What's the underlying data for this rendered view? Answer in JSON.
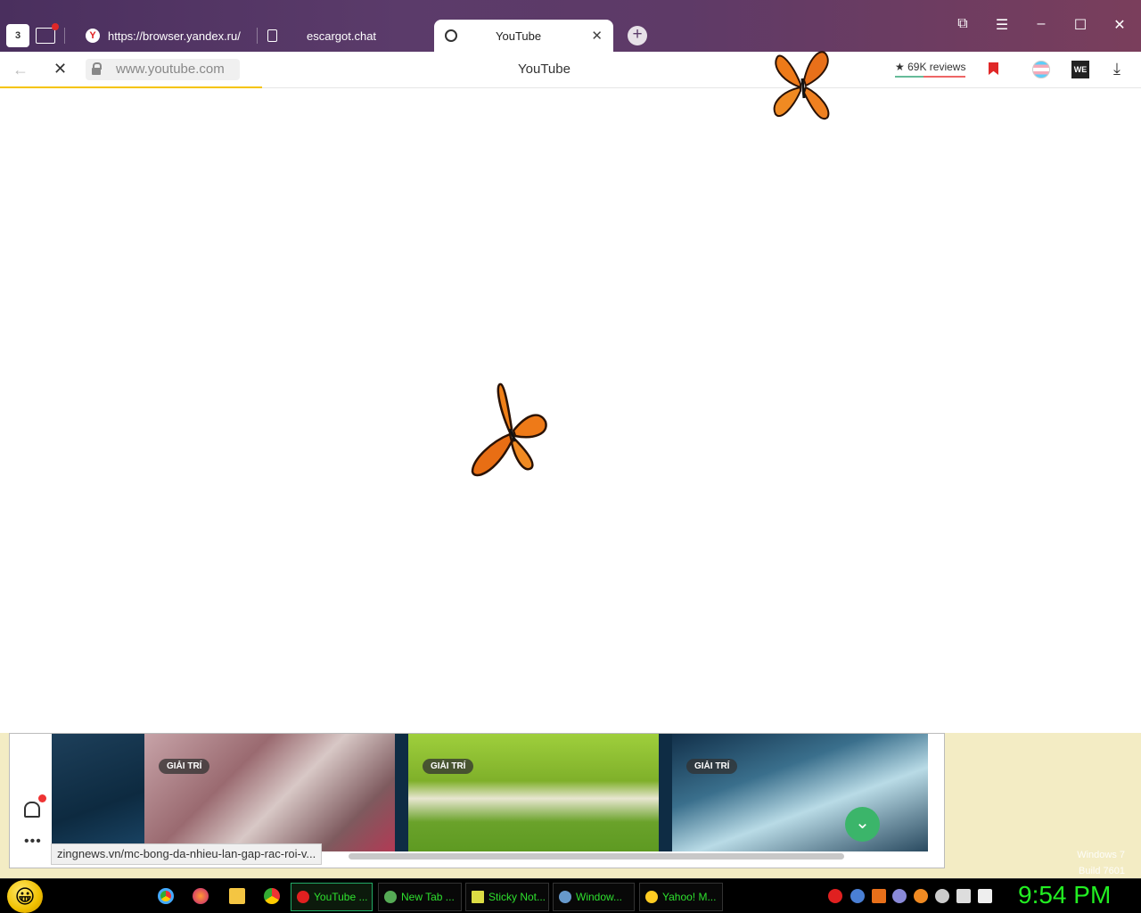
{
  "browser": {
    "tab_count": "3",
    "tabs": [
      {
        "label": "https://browser.yandex.ru/",
        "icon": "yandex-icon"
      },
      {
        "label": "escargot.chat",
        "icon": "document-icon"
      },
      {
        "label": "YouTube",
        "icon": "loading-ring-icon",
        "active": true
      }
    ],
    "address": "www.youtube.com",
    "page_title": "YouTube",
    "reviews": "★ 69K reviews",
    "extension_label": "WE",
    "load_progress": 0.23
  },
  "news": {
    "cards": [
      {
        "tag": "GIẢI TRÍ"
      },
      {
        "tag": "GIẢI TRÍ"
      },
      {
        "tag": "GIẢI TRÍ"
      }
    ],
    "status_url": "zingnews.vn/mc-bong-da-nhieu-lan-gap-rac-roi-v..."
  },
  "desktop": {
    "watermark_line1": "Windows 7",
    "watermark_line2": "Build 7601"
  },
  "taskbar": {
    "tasks": [
      {
        "label": "YouTube ...",
        "active": true
      },
      {
        "label": "New Tab ..."
      },
      {
        "label": "Sticky Not..."
      },
      {
        "label": "Window..."
      },
      {
        "label": "Yahoo! M..."
      }
    ],
    "clock": "9:54 PM"
  },
  "colors": {
    "titlebar": "#5b3b6a",
    "load_bar": "#f5c400",
    "clock": "#22ee22",
    "task_text": "#2ee02e"
  }
}
